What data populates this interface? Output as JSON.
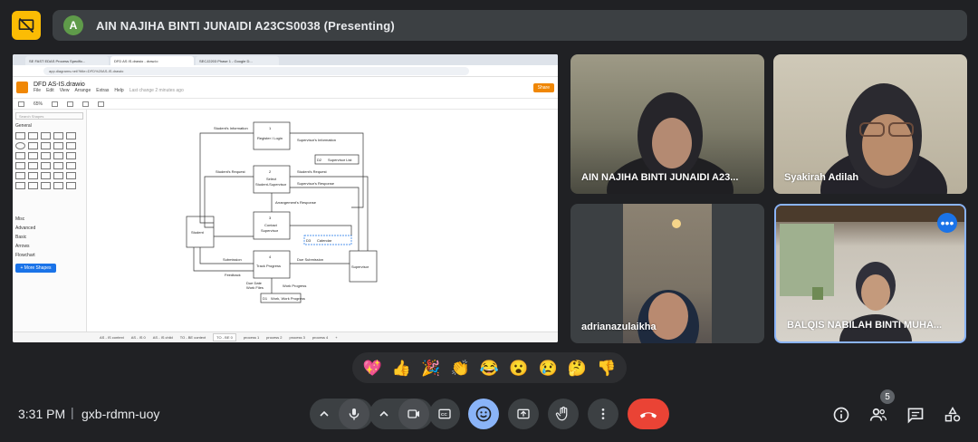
{
  "presenter": {
    "avatar_letter": "A",
    "title": "AIN NAJIHA BINTI JUNAIDI A23CS0038 (Presenting)"
  },
  "shared_screen": {
    "browser_tabs": [
      "SE FAST EDAS Process Specific...",
      "DFD AS IS.drawio - draw.io",
      "SECJ2203 Phase 1 - Google D..."
    ],
    "address": "app.diagrams.net/?title=DFD%20AS-IS.drawio",
    "doc_title": "DFD AS-IS.drawio",
    "menu": [
      "File",
      "Edit",
      "View",
      "Arrange",
      "Extras",
      "Help",
      "Last change 2 minutes ago"
    ],
    "share_label": "Share",
    "zoom": "65%",
    "search_placeholder": "Search Shapes",
    "general_label": "General",
    "categories": [
      "Misc",
      "Advanced",
      "Basic",
      "Arrows",
      "Flowchart"
    ],
    "more_shapes_label": "+ More Shapes",
    "page_tabs": [
      "AS - IS context",
      "AS - IS 0",
      "AS - IS child",
      "TO - BE context",
      "TO - BE 0",
      "process 1",
      "process 2",
      "process 3",
      "process 4",
      "+"
    ],
    "active_page_index": 4,
    "diagram": {
      "process_1": [
        "1",
        "Register / Login"
      ],
      "process_2": [
        "2",
        "Select",
        "Student-Supervisor"
      ],
      "process_3": [
        "3",
        "Contact",
        "Supervisor"
      ],
      "process_4": [
        "4",
        "Track Progress"
      ],
      "entity_student": "Student",
      "entity_supervisor": "Supervisor",
      "store_d2": [
        "D2",
        "Supervisor List"
      ],
      "store_d3": [
        "D3",
        "Calendar"
      ],
      "store_d1": [
        "D1",
        "Work, Work Progress"
      ],
      "flows": {
        "login_info": "Student's Information",
        "sup_info": "Supervisor's Information",
        "student_request": "Student's Request",
        "sup_request": "Student's Request",
        "sup_response": "Supervisor's Response",
        "meeting_response": "Arrangement's Response",
        "submission": "Submission",
        "feedback": "Feedback",
        "due_submission": "Due Submission",
        "due_date": "Due Date",
        "work_files": "Work Files",
        "work_progress": "Work Progress"
      }
    }
  },
  "participants": [
    {
      "name": "AIN NAJIHA BINTI JUNAIDI A23..."
    },
    {
      "name": "Syakirah Adilah"
    },
    {
      "name": "adrianazulaikha"
    },
    {
      "name": "BALQIS NABILAH BINTI MUHA..."
    }
  ],
  "reactions": [
    "💖",
    "👍",
    "🎉",
    "👏",
    "😂",
    "😮",
    "😢",
    "🤔",
    "👎"
  ],
  "bottom_bar": {
    "time": "3:31 PM",
    "separator": "|",
    "meeting_code": "gxb-rdmn-uoy",
    "people_count": "5"
  },
  "colors": {
    "background": "#202124",
    "present_icon": "#fbbc04",
    "end_call": "#ea4335",
    "reaction_active": "#8ab4f8",
    "active_speaker": "#8ab4f8"
  }
}
